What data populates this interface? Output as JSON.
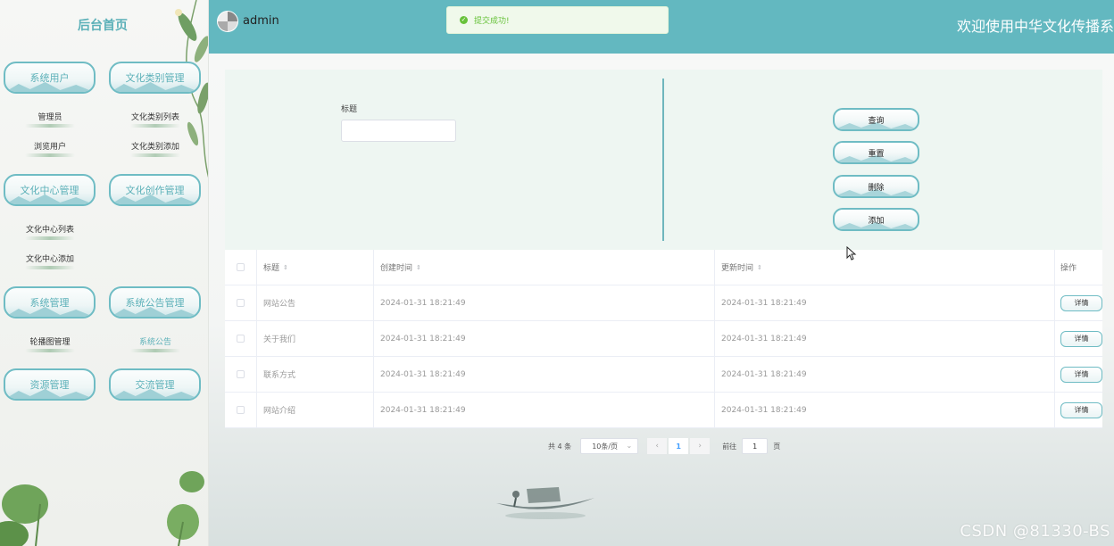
{
  "sidebar": {
    "title": "后台首页",
    "menus": [
      {
        "label": "系统用户",
        "subitems": [
          "管理员",
          "浏览用户"
        ]
      },
      {
        "label": "文化类别管理",
        "subitems": [
          "文化类别列表",
          "文化类别添加"
        ]
      },
      {
        "label": "文化中心管理",
        "subitems": [
          "文化中心列表",
          "文化中心添加"
        ]
      },
      {
        "label": "文化创作管理",
        "subitems": []
      },
      {
        "label": "系统管理",
        "subitems": [
          "轮播图管理"
        ]
      },
      {
        "label": "系统公告管理",
        "subitems": [
          "系统公告"
        ]
      },
      {
        "label": "资源管理",
        "subitems": []
      },
      {
        "label": "交流管理",
        "subitems": []
      }
    ]
  },
  "header": {
    "username": "admin",
    "welcome": "欢迎使用中华文化传播系统"
  },
  "toast": {
    "message": "提交成功!"
  },
  "search": {
    "title_label": "标题",
    "title_value": "",
    "buttons": {
      "query": "查询",
      "reset": "重置",
      "delete": "删除",
      "add": "添加"
    }
  },
  "table": {
    "headers": {
      "title": "标题",
      "created": "创建时间",
      "updated": "更新时间",
      "ops": "操作"
    },
    "rows": [
      {
        "title": "网站公告",
        "created": "2024-01-31 18:21:49",
        "updated": "2024-01-31 18:21:49",
        "action": "详情"
      },
      {
        "title": "关于我们",
        "created": "2024-01-31 18:21:49",
        "updated": "2024-01-31 18:21:49",
        "action": "详情"
      },
      {
        "title": "联系方式",
        "created": "2024-01-31 18:21:49",
        "updated": "2024-01-31 18:21:49",
        "action": "详情"
      },
      {
        "title": "网站介绍",
        "created": "2024-01-31 18:21:49",
        "updated": "2024-01-31 18:21:49",
        "action": "详情"
      }
    ]
  },
  "pagination": {
    "total": "共 4 条",
    "page_size": "10条/页",
    "current_page": "1",
    "goto_prefix": "前往",
    "goto_value": "1",
    "goto_suffix": "页"
  },
  "watermark": "CSDN @81330-BS",
  "colors": {
    "header": "#63b8c0",
    "accent": "#6fbcc4",
    "panel": "#eef6f2",
    "toast_green": "#67c23a"
  }
}
